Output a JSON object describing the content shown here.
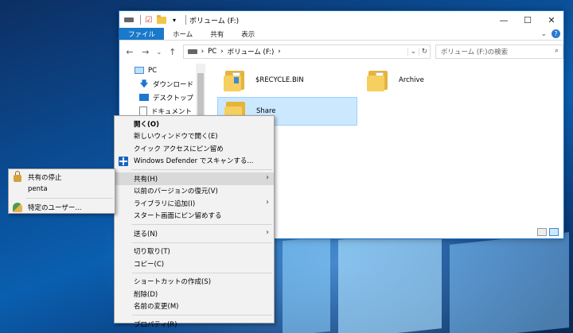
{
  "explorer": {
    "title": "ボリューム (F:)",
    "controls": {
      "minimize": "—",
      "maximize": "☐",
      "close": "✕"
    },
    "ribbon_tabs": [
      "ファイル",
      "ホーム",
      "共有",
      "表示"
    ],
    "ribbon_right": {
      "chevron": "⌄",
      "help": "?"
    },
    "nav": {
      "back": "←",
      "forward": "→",
      "recent": "⌄",
      "up": "↑"
    },
    "address": {
      "pc": "PC",
      "sep1": "›",
      "volume": "ボリューム (F:)",
      "sep2": "›",
      "dropdown": "⌄",
      "refresh": "↻"
    },
    "search": {
      "placeholder": "ボリューム (F:)の検索",
      "icon": "⌕"
    },
    "navpane": [
      "PC",
      "ダウンロード",
      "デスクトップ",
      "ドキュメント"
    ],
    "items": [
      "$RECYCLE.BIN",
      "Archive",
      "Share"
    ]
  },
  "context_menu": {
    "items": [
      {
        "label": "開く(O)"
      },
      {
        "label": "新しいウィンドウで開く(E)"
      },
      {
        "label": "クイック アクセスにピン留め"
      },
      {
        "label": "Windows Defender でスキャンする..."
      },
      {
        "label": "共有(H)"
      },
      {
        "label": "以前のバージョンの復元(V)"
      },
      {
        "label": "ライブラリに追加(I)"
      },
      {
        "label": "スタート画面にピン留めする"
      },
      {
        "label": "送る(N)"
      },
      {
        "label": "切り取り(T)"
      },
      {
        "label": "コピー(C)"
      },
      {
        "label": "ショートカットの作成(S)"
      },
      {
        "label": "削除(D)"
      },
      {
        "label": "名前の変更(M)"
      },
      {
        "label": "プロパティ(R)"
      }
    ],
    "submenu_arrow": "›"
  },
  "share_submenu": {
    "items": [
      "共有の停止",
      "penta",
      "特定のユーザー..."
    ]
  }
}
